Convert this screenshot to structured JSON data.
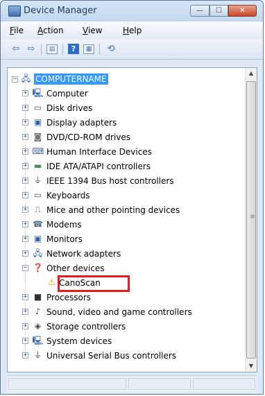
{
  "window": {
    "title": "Device Manager"
  },
  "title_controls": {
    "minimize": "—",
    "maximize": "☐",
    "close": "✕"
  },
  "menu": {
    "items": [
      {
        "key": "F",
        "rest": "ile"
      },
      {
        "key": "A",
        "rest": "ction"
      },
      {
        "key": "V",
        "rest": "iew"
      },
      {
        "key": "H",
        "rest": "elp"
      }
    ]
  },
  "toolbar": {
    "icons": [
      "back-icon",
      "forward-icon",
      "properties-icon",
      "help-icon",
      "view-icon",
      "scan-hardware-icon"
    ],
    "help_glyph": "?"
  },
  "tree": {
    "root": "COMPUTERNAME",
    "categories": [
      {
        "label": "Computer",
        "icon": "computer-icon"
      },
      {
        "label": "Disk drives",
        "icon": "disk-drive-icon"
      },
      {
        "label": "Display adapters",
        "icon": "display-adapter-icon"
      },
      {
        "label": "DVD/CD-ROM drives",
        "icon": "dvd-drive-icon"
      },
      {
        "label": "Human Interface Devices",
        "icon": "hid-icon"
      },
      {
        "label": "IDE ATA/ATAPI controllers",
        "icon": "ide-controller-icon"
      },
      {
        "label": "IEEE 1394 Bus host controllers",
        "icon": "ieee1394-icon"
      },
      {
        "label": "Keyboards",
        "icon": "keyboard-icon"
      },
      {
        "label": "Mice and other pointing devices",
        "icon": "mouse-icon"
      },
      {
        "label": "Modems",
        "icon": "modem-icon"
      },
      {
        "label": "Monitors",
        "icon": "monitor-icon"
      },
      {
        "label": "Network adapters",
        "icon": "network-adapter-icon"
      },
      {
        "label": "Other devices",
        "icon": "other-devices-icon",
        "expanded": true
      },
      {
        "label": "Processors",
        "icon": "processor-icon"
      },
      {
        "label": "Sound, video and game controllers",
        "icon": "sound-icon"
      },
      {
        "label": "Storage controllers",
        "icon": "storage-controller-icon"
      },
      {
        "label": "System devices",
        "icon": "system-devices-icon"
      },
      {
        "label": "Universal Serial Bus controllers",
        "icon": "usb-icon"
      }
    ],
    "other_devices_child": {
      "label": "CanoScan",
      "icon": "warning-device-icon"
    }
  },
  "colors": {
    "selection": "#3399ff",
    "highlight_box": "#e01e24",
    "title_text": "#1e395b"
  }
}
